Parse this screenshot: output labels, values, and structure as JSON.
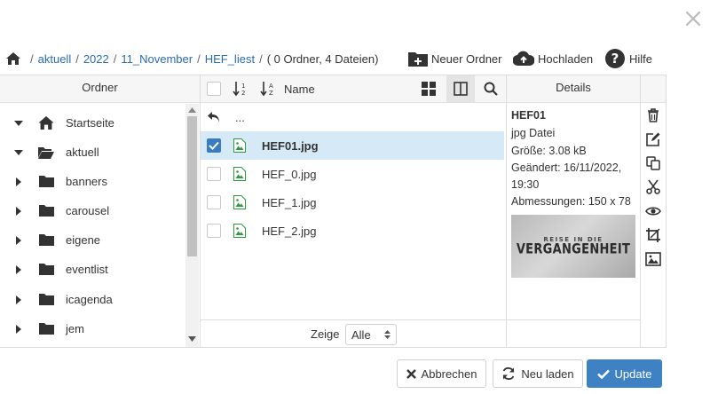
{
  "breadcrumb": {
    "items": [
      "aktuell",
      "2022",
      "11_November",
      "HEF_liest"
    ],
    "summary": "( 0 Ordner, 4 Dateien)"
  },
  "toolbar": {
    "new_folder": "Neuer Ordner",
    "upload": "Hochladen",
    "help": "Hilfe"
  },
  "folders_panel": {
    "title": "Ordner",
    "items": [
      {
        "label": "Startseite",
        "icon": "home-icon",
        "expanded": true
      },
      {
        "label": "aktuell",
        "icon": "folder-open-icon",
        "expanded": true
      },
      {
        "label": "banners",
        "icon": "folder-icon",
        "expanded": false
      },
      {
        "label": "carousel",
        "icon": "folder-icon",
        "expanded": false
      },
      {
        "label": "eigene",
        "icon": "folder-icon",
        "expanded": false
      },
      {
        "label": "eventlist",
        "icon": "folder-icon",
        "expanded": false
      },
      {
        "label": "icagenda",
        "icon": "folder-icon",
        "expanded": false
      },
      {
        "label": "jem",
        "icon": "folder-icon",
        "expanded": false
      }
    ]
  },
  "files_panel": {
    "name_header": "Name",
    "up_label": "...",
    "files": [
      {
        "name": "HEF01.jpg",
        "selected": true
      },
      {
        "name": "HEF_0.jpg",
        "selected": false
      },
      {
        "name": "HEF_1.jpg",
        "selected": false
      },
      {
        "name": "HEF_2.jpg",
        "selected": false
      }
    ],
    "show_label": "Zeige",
    "show_value": "Alle"
  },
  "details_panel": {
    "title": "Details",
    "filename": "HEF01",
    "type": "jpg Datei",
    "size": "Größe: 3.08 kB",
    "changed_1": "Geändert: 16/11/2022,",
    "changed_2": "19:30",
    "dimensions": "Abmessungen: 150 x 78",
    "preview_line1": "REISE IN DIE",
    "preview_line2": "VERGANGENHEIT"
  },
  "footer": {
    "cancel": "Abbrechen",
    "reload": "Neu laden",
    "update": "Update"
  },
  "colors": {
    "link": "#2a6ab3",
    "selected_row": "#d5e9f7",
    "primary": "#3f82c4",
    "file_icon": "#2e9a3e"
  }
}
